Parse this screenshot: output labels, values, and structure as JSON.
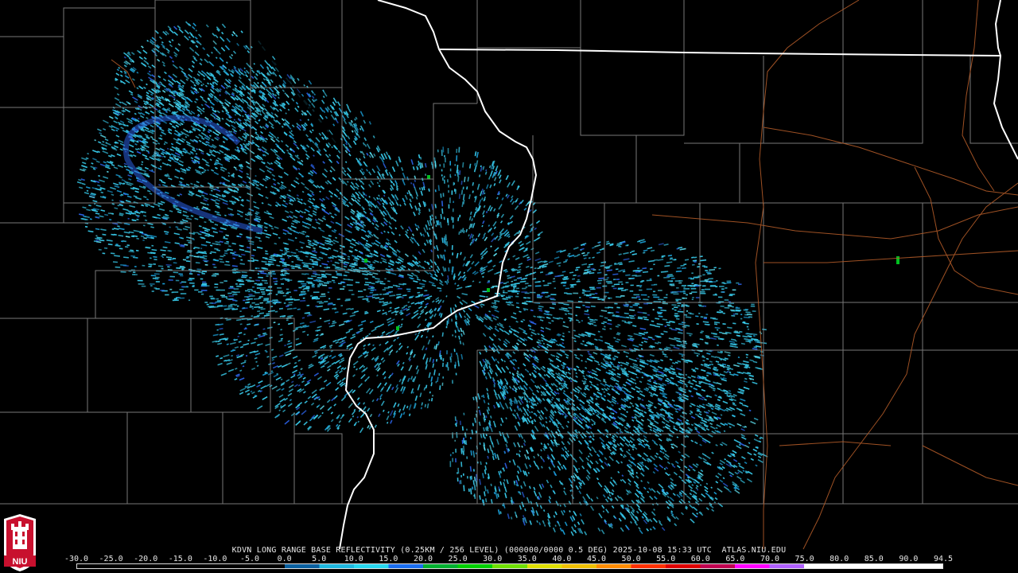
{
  "product": {
    "caption": "KDVN LONG RANGE BASE REFLECTIVITY (0.25KM / 256 LEVEL) (000000/0000 0.5 DEG) 2025-10-08 15:33 UTC  ATLAS.NIU.EDU"
  },
  "colorbar": {
    "ticks": [
      "-30.0",
      "-25.0",
      "-20.0",
      "-15.0",
      "-10.0",
      "-5.0",
      "0.0",
      "5.0",
      "10.0",
      "15.0",
      "20.0",
      "25.0",
      "30.0",
      "35.0",
      "40.0",
      "45.0",
      "50.0",
      "55.0",
      "60.0",
      "65.0",
      "70.0",
      "75.0",
      "80.0",
      "85.0",
      "90.0",
      "94.5"
    ],
    "colors": [
      "#000000",
      "#000000",
      "#000000",
      "#000000",
      "#000000",
      "#000000",
      "#0a60a0",
      "#1fb8e0",
      "#28d8f0",
      "#1a6ef0",
      "#00b030",
      "#00d000",
      "#70e000",
      "#e0e000",
      "#f0c000",
      "#ff8c00",
      "#ff3000",
      "#e00000",
      "#c00050",
      "#ff00ff",
      "#b060ff",
      "#ffffff",
      "#ffffff",
      "#ffffff",
      "#ffffff"
    ]
  },
  "logo": {
    "text": "NIU"
  },
  "map_style": {
    "background": "#000000",
    "state_border_color": "#ffffff",
    "county_color": "#a0a0a0",
    "highway_color": "#b05a28",
    "echo_colors": [
      "#37c8e8",
      "#1a9fd8",
      "#2a5fe0",
      "#5fe0f0"
    ]
  }
}
